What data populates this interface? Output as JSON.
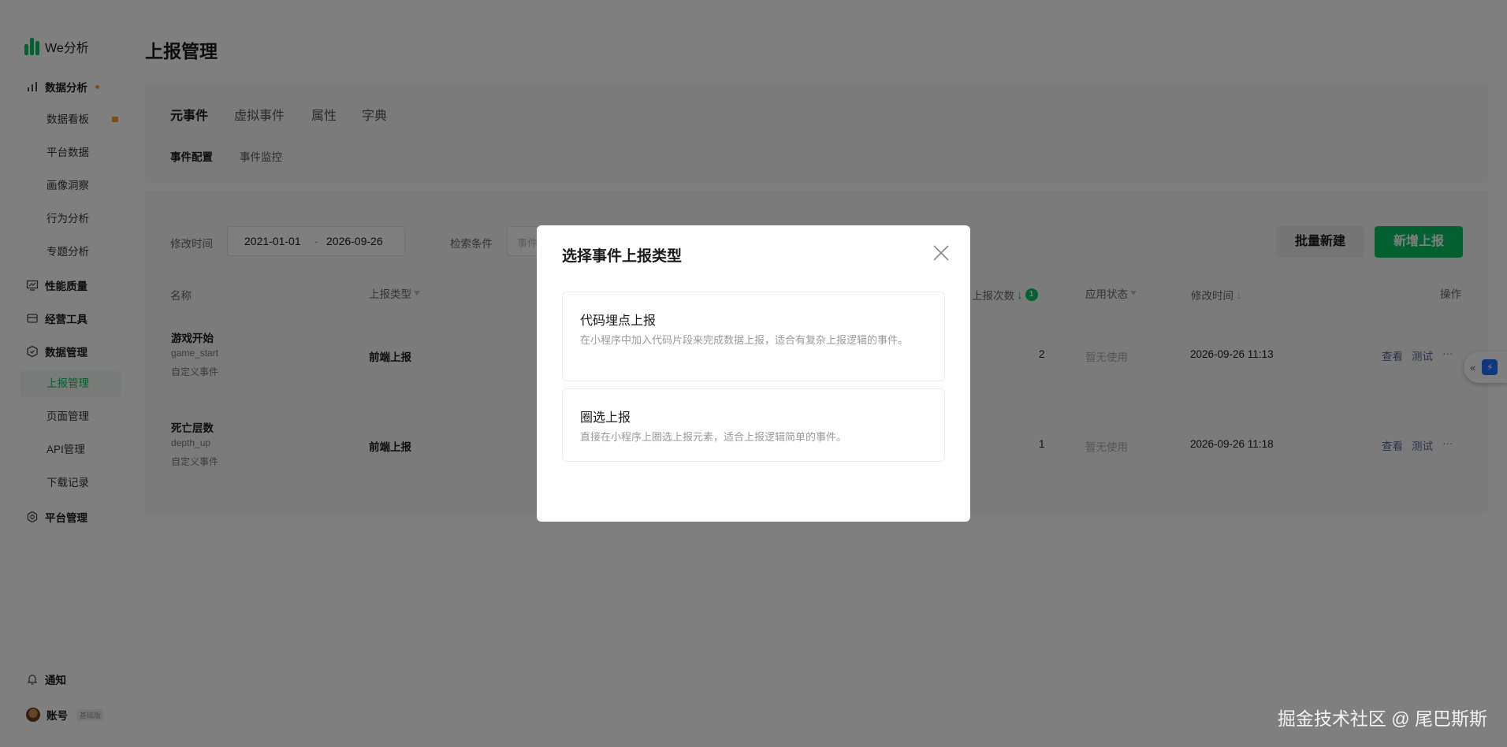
{
  "app": {
    "name": "We分析"
  },
  "sidebar": {
    "groups": [
      {
        "label": "数据分析",
        "icon": "bar-chart-icon"
      },
      {
        "label": "性能质量",
        "icon": "monitor-icon"
      },
      {
        "label": "经营工具",
        "icon": "storefront-icon"
      },
      {
        "label": "数据管理",
        "icon": "shield-icon"
      },
      {
        "label": "平台管理",
        "icon": "gear-icon"
      }
    ],
    "analysis_items": [
      "数据看板",
      "平台数据",
      "画像洞察",
      "行为分析",
      "专题分析"
    ],
    "data_items": [
      "上报管理",
      "页面管理",
      "API管理",
      "下载记录"
    ],
    "bottom": {
      "notify": "通知",
      "account": "账号",
      "edition": "基础版"
    },
    "colors": {
      "accent": "#07c160",
      "badge": "#fa9d3b"
    }
  },
  "page": {
    "title": "上报管理"
  },
  "tabs": [
    "元事件",
    "虚拟事件",
    "属性",
    "字典"
  ],
  "subtabs": [
    "事件配置",
    "事件监控"
  ],
  "filters": {
    "time_label": "修改时间",
    "date_start": "2021-01-01",
    "date_sep": "-",
    "date_end": "2026-09-26",
    "search_label": "检索条件",
    "search_placeholder": "事件"
  },
  "buttons": {
    "batch_create": "批量新建",
    "add_report": "新增上报"
  },
  "table": {
    "headers": {
      "name": "名称",
      "type": "上报类型",
      "count": "上报次数",
      "count_badge": "1",
      "status": "应用状态",
      "modified": "修改时间",
      "ops": "操作"
    },
    "rows": [
      {
        "name": "游戏开始",
        "key": "game_start",
        "category": "自定义事件",
        "type": "前端上报",
        "count": "2",
        "status": "暂无使用",
        "modified": "2026-09-26 11:13",
        "view": "查看",
        "test": "测试",
        "more": "···"
      },
      {
        "name": "死亡层数",
        "key": "depth_up",
        "category": "自定义事件",
        "type": "前端上报",
        "count": "1",
        "status": "暂无使用",
        "modified": "2026-09-26 11:18",
        "view": "查看",
        "test": "测试",
        "more": "···"
      }
    ]
  },
  "modal": {
    "title": "选择事件上报类型",
    "options": [
      {
        "title": "代码埋点上报",
        "desc": "在小程序中加入代码片段来完成数据上报，适合有复杂上报逻辑的事件。"
      },
      {
        "title": "圈选上报",
        "desc": "直接在小程序上圈选上报元素，适合上报逻辑简单的事件。"
      }
    ]
  },
  "watermark": "掘金技术社区 @ 尾巴斯斯"
}
